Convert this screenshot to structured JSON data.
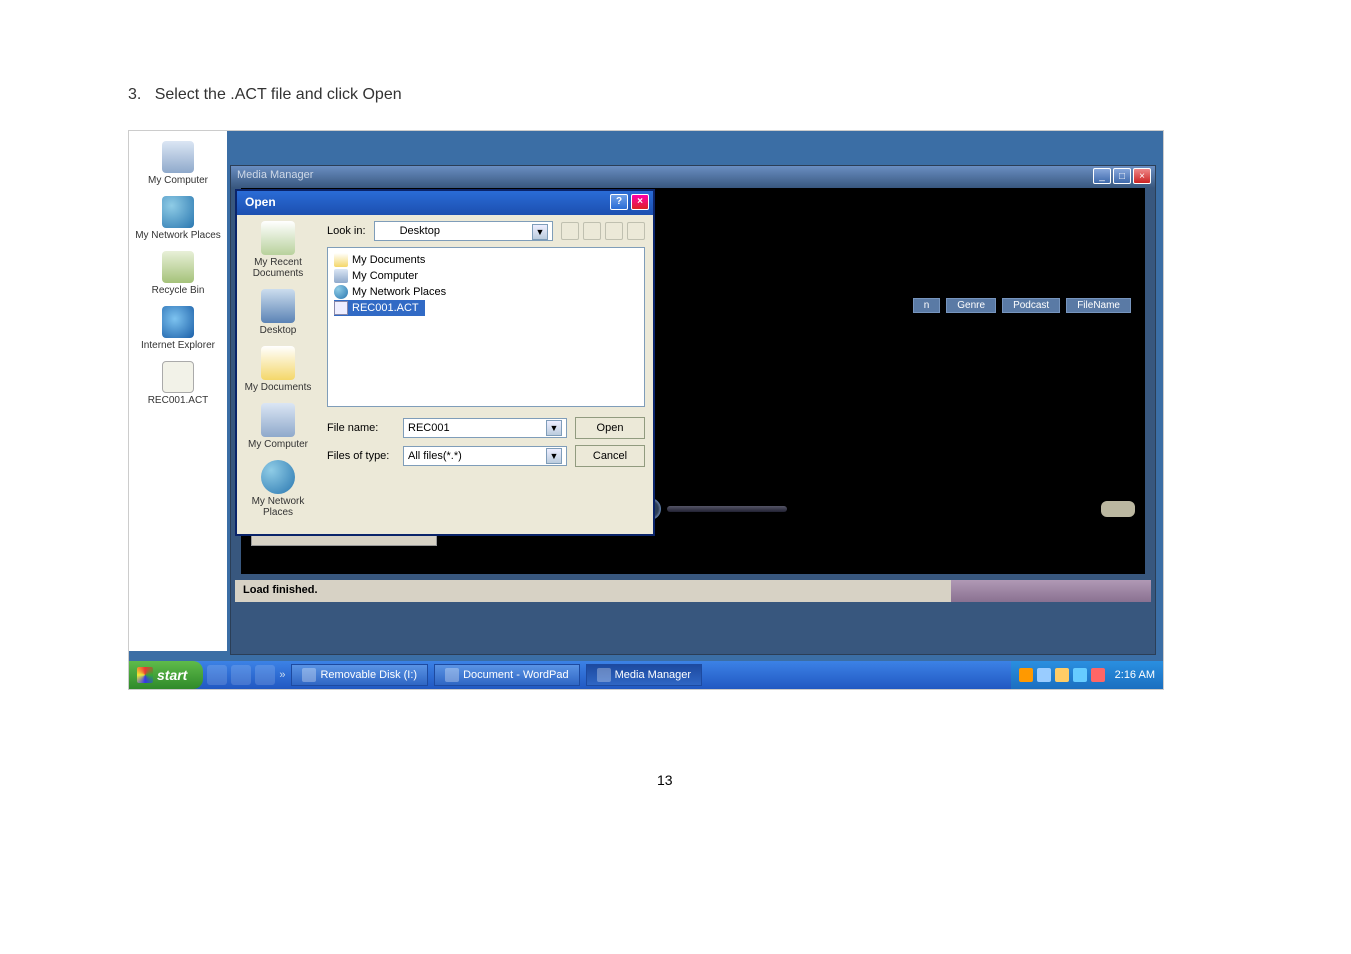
{
  "instruction": {
    "number": "3.",
    "text": "Select the .ACT file and click Open"
  },
  "page_number": "13",
  "desktop_icons": [
    {
      "label": "My Computer",
      "cls": "ic-comp"
    },
    {
      "label": "My Network Places",
      "cls": "ic-net"
    },
    {
      "label": "Recycle Bin",
      "cls": "ic-bin"
    },
    {
      "label": "Internet Explorer",
      "cls": "ic-ie"
    },
    {
      "label": "REC001.ACT",
      "cls": "ic-file"
    }
  ],
  "media_manager": {
    "title": "Media Manager",
    "columns": [
      "n",
      "Genre",
      "Podcast",
      "FileName"
    ],
    "status": "Load finished."
  },
  "open_dialog": {
    "title": "Open",
    "lookin_label": "Look in:",
    "lookin_value": "Desktop",
    "places": [
      {
        "label": "My Recent Documents",
        "cls": "recent"
      },
      {
        "label": "Desktop",
        "cls": "desk"
      },
      {
        "label": "My Documents",
        "cls": "docs"
      },
      {
        "label": "My Computer",
        "cls": "comp"
      },
      {
        "label": "My Network Places",
        "cls": "net"
      }
    ],
    "files": [
      {
        "label": "My Documents",
        "cls": "folder",
        "sel": false
      },
      {
        "label": "My Computer",
        "cls": "comp",
        "sel": false
      },
      {
        "label": "My Network Places",
        "cls": "net",
        "sel": false
      },
      {
        "label": "REC001.ACT",
        "cls": "file",
        "sel": true
      }
    ],
    "filename_label": "File name:",
    "filename_value": "REC001",
    "filetype_label": "Files of type:",
    "filetype_value": "All files(*.*)",
    "open_btn": "Open",
    "cancel_btn": "Cancel"
  },
  "taskbar": {
    "start": "start",
    "items": [
      {
        "label": "Removable Disk (I:)",
        "active": false
      },
      {
        "label": "Document - WordPad",
        "active": false
      },
      {
        "label": "Media Manager",
        "active": true
      }
    ],
    "time": "2:16 AM"
  }
}
